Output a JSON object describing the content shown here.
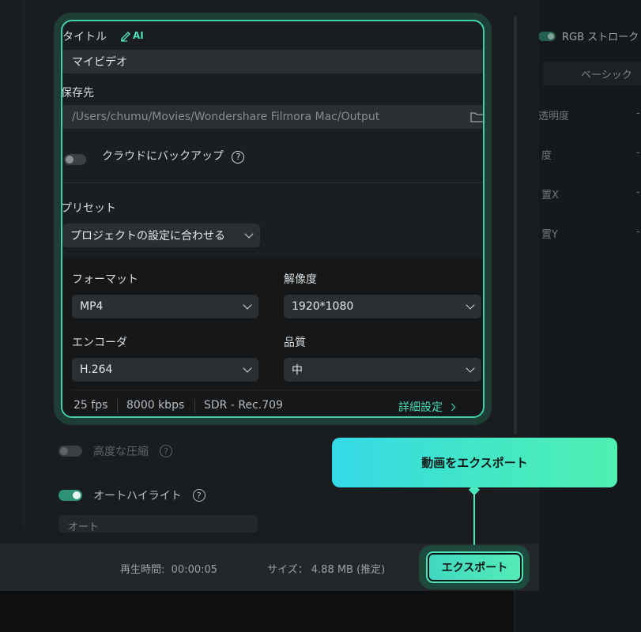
{
  "right_panel": {
    "stroke_label": "RGB ストローク",
    "tab": "ベーシック",
    "rows": [
      "透明度",
      "度",
      "置X",
      "置Y"
    ],
    "dash": "-"
  },
  "settings": {
    "title_label": "タイトル",
    "ai_badge": "AI",
    "title_value": "マイビデオ",
    "save_label": "保存先",
    "save_path": "/Users/chumu/Movies/Wondershare Filmora Mac/Output",
    "cloud_backup_label": "クラウドにバックアップ",
    "preset_label": "プリセット",
    "preset_value": "プロジェクトの設定に合わせる",
    "format_label": "フォーマット",
    "format_value": "MP4",
    "resolution_label": "解像度",
    "resolution_value": "1920*1080",
    "encoder_label": "エンコーダ",
    "encoder_value": "H.264",
    "quality_label": "品質",
    "quality_value": "中",
    "fps": "25 fps",
    "bitrate": "8000 kbps",
    "color_space": "SDR - Rec.709",
    "advanced_label": "詳細設定",
    "help_glyph": "?"
  },
  "background": {
    "advanced_compression_label": "高度な圧縮",
    "auto_highlight_label": "オートハイライト",
    "auto_select_value": "オート",
    "duration_label": "再生時間:",
    "duration_value": "00:00:05",
    "size_label": "サイズ：",
    "size_value": "4.88 MB (推定)"
  },
  "tooltip": {
    "text": "動画をエクスポート"
  },
  "export_button": {
    "label": "エクスポート"
  },
  "colors": {
    "accent": "#43dcb2",
    "tooltip_start": "#35d9e8",
    "tooltip_end": "#4ff0b2"
  }
}
